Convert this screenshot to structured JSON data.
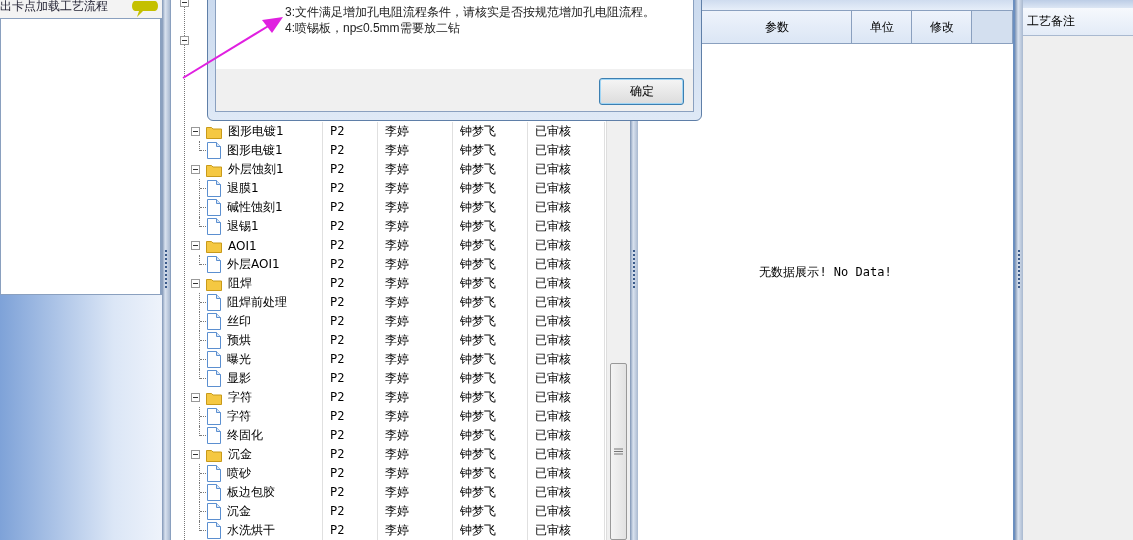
{
  "left_panel": {
    "title": "出卡点加载工艺流程"
  },
  "tree": {
    "groups": [
      {
        "name": "图形电镀1",
        "version": "P2",
        "maker": "李婷",
        "reviewer": "钟梦飞",
        "status": "已审核",
        "expanded": true,
        "children": [
          {
            "name": "图形电镀1",
            "version": "P2",
            "maker": "李婷",
            "reviewer": "钟梦飞",
            "status": "已审核"
          }
        ]
      },
      {
        "name": "外层蚀刻1",
        "version": "P2",
        "maker": "李婷",
        "reviewer": "钟梦飞",
        "status": "已审核",
        "expanded": true,
        "children": [
          {
            "name": "退膜1",
            "version": "P2",
            "maker": "李婷",
            "reviewer": "钟梦飞",
            "status": "已审核"
          },
          {
            "name": "碱性蚀刻1",
            "version": "P2",
            "maker": "李婷",
            "reviewer": "钟梦飞",
            "status": "已审核"
          },
          {
            "name": "退锡1",
            "version": "P2",
            "maker": "李婷",
            "reviewer": "钟梦飞",
            "status": "已审核"
          }
        ]
      },
      {
        "name": "AOI1",
        "version": "P2",
        "maker": "李婷",
        "reviewer": "钟梦飞",
        "status": "已审核",
        "expanded": true,
        "children": [
          {
            "name": "外层AOI1",
            "version": "P2",
            "maker": "李婷",
            "reviewer": "钟梦飞",
            "status": "已审核"
          }
        ]
      },
      {
        "name": "阻焊",
        "version": "P2",
        "maker": "李婷",
        "reviewer": "钟梦飞",
        "status": "已审核",
        "expanded": true,
        "children": [
          {
            "name": "阻焊前处理",
            "version": "P2",
            "maker": "李婷",
            "reviewer": "钟梦飞",
            "status": "已审核"
          },
          {
            "name": "丝印",
            "version": "P2",
            "maker": "李婷",
            "reviewer": "钟梦飞",
            "status": "已审核"
          },
          {
            "name": "预烘",
            "version": "P2",
            "maker": "李婷",
            "reviewer": "钟梦飞",
            "status": "已审核"
          },
          {
            "name": "曝光",
            "version": "P2",
            "maker": "李婷",
            "reviewer": "钟梦飞",
            "status": "已审核"
          },
          {
            "name": "显影",
            "version": "P2",
            "maker": "李婷",
            "reviewer": "钟梦飞",
            "status": "已审核"
          }
        ]
      },
      {
        "name": "字符",
        "version": "P2",
        "maker": "李婷",
        "reviewer": "钟梦飞",
        "status": "已审核",
        "expanded": true,
        "children": [
          {
            "name": "字符",
            "version": "P2",
            "maker": "李婷",
            "reviewer": "钟梦飞",
            "status": "已审核"
          },
          {
            "name": "终固化",
            "version": "P2",
            "maker": "李婷",
            "reviewer": "钟梦飞",
            "status": "已审核"
          }
        ]
      },
      {
        "name": "沉金",
        "version": "P2",
        "maker": "李婷",
        "reviewer": "钟梦飞",
        "status": "已审核",
        "expanded": true,
        "children": [
          {
            "name": "喷砂",
            "version": "P2",
            "maker": "李婷",
            "reviewer": "钟梦飞",
            "status": "已审核"
          },
          {
            "name": "板边包胶",
            "version": "P2",
            "maker": "李婷",
            "reviewer": "钟梦飞",
            "status": "已审核"
          },
          {
            "name": "沉金",
            "version": "P2",
            "maker": "李婷",
            "reviewer": "钟梦飞",
            "status": "已审核"
          },
          {
            "name": "水洗烘干",
            "version": "P2",
            "maker": "李婷",
            "reviewer": "钟梦飞",
            "status": "已审核"
          }
        ]
      }
    ]
  },
  "params_table": {
    "columns": [
      "参数",
      "单位",
      "修改"
    ],
    "empty_text": "无数据展示! No Data!"
  },
  "notes_panel": {
    "header": "工艺备注"
  },
  "dialog": {
    "messages": [
      "3:文件满足增加孔电阻流程条件，请核实是否按规范增加孔电阻流程。",
      "4:喷锡板，np≤0.5mm需要放二钻"
    ],
    "button": "确定"
  }
}
